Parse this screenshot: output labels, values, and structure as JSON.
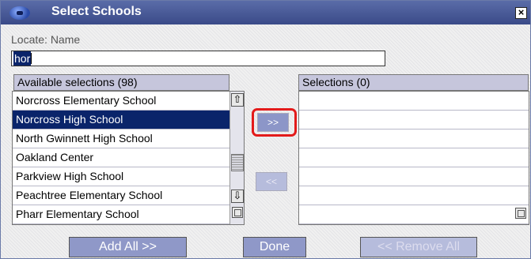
{
  "window": {
    "title": "Select Schools",
    "close_glyph": "×",
    "logo_icon": "app-logo-icon"
  },
  "locate": {
    "label": "Locate: Name",
    "value": "hor"
  },
  "available": {
    "header": "Available selections (98)",
    "items": [
      "Norcross Elementary School",
      "Norcross High School",
      "North Gwinnett High School",
      "Oakland Center",
      "Parkview High School",
      "Peachtree Elementary School",
      "Pharr Elementary School"
    ],
    "selected_item": "Norcross High School"
  },
  "selections": {
    "header": "Selections (0)",
    "items": []
  },
  "transfer": {
    "add_label": ">>",
    "remove_label": "<<"
  },
  "scroll": {
    "up_glyph": "⇧",
    "down_glyph": "⇩"
  },
  "buttons": {
    "add_all": "Add All >>",
    "done": "Done",
    "remove_all": "<< Remove All"
  },
  "colors": {
    "title_bar": "#3a4a88",
    "selection": "#0a246a",
    "highlight": "#e31b1b",
    "button": "#8f98c8"
  }
}
